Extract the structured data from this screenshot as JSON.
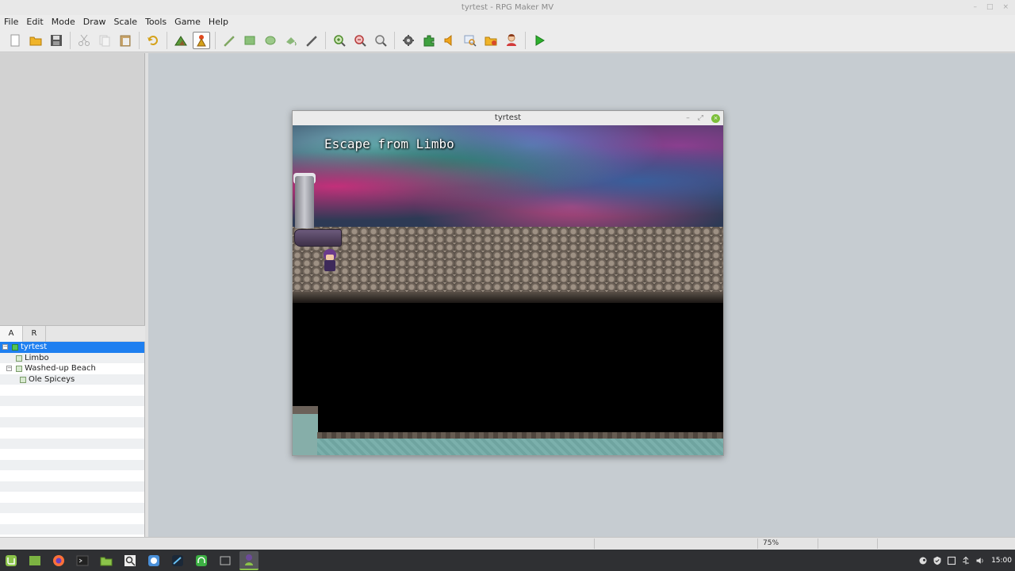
{
  "window": {
    "title": "tyrtest - RPG Maker MV",
    "minimize": "–",
    "maximize": "□",
    "close": "×"
  },
  "menu": [
    "File",
    "Edit",
    "Mode",
    "Draw",
    "Scale",
    "Tools",
    "Game",
    "Help"
  ],
  "toolbar": {
    "icons": [
      "new-icon",
      "open-icon",
      "save-icon",
      "cut-icon",
      "copy-icon",
      "paste-icon",
      "undo-icon",
      "map-mode-icon",
      "event-mode-icon",
      "pencil-icon",
      "rectangle-icon",
      "ellipse-icon",
      "fill-icon",
      "shadow-pen-icon",
      "zoom-in-icon",
      "zoom-out-icon",
      "zoom-actual-icon",
      "database-icon",
      "plugin-manager-icon",
      "sound-test-icon",
      "event-search-icon",
      "resource-manager-icon",
      "character-generator-icon",
      "playtest-icon"
    ],
    "pressed": "event-mode-icon"
  },
  "tabs": {
    "a": "A",
    "r": "R"
  },
  "map_tree": {
    "items": [
      {
        "label": "tyrtest",
        "level": 0,
        "selected": true,
        "expander": "−"
      },
      {
        "label": "Limbo",
        "level": 1,
        "selected": false,
        "expander": ""
      },
      {
        "label": "Washed-up Beach",
        "level": 1,
        "selected": false,
        "expander": "−"
      },
      {
        "label": "Ole Spiceys",
        "level": 2,
        "selected": false,
        "expander": ""
      }
    ]
  },
  "game_window": {
    "title": "tyrtest",
    "minimize": "–",
    "maximize": "⤢",
    "close": "×",
    "map_name": "Escape from Limbo"
  },
  "statusbar": {
    "zoom": "75%"
  },
  "taskbar": {
    "apps": [
      "mint-menu-icon",
      "show-desktop-icon",
      "firefox-icon",
      "terminal-icon",
      "files-icon",
      "search-tool-icon",
      "chromium-icon",
      "steam-icon",
      "headset-icon",
      "window-icon",
      "rpg-maker-icon"
    ],
    "active": "rpg-maker-icon"
  },
  "tray": {
    "icons": [
      "steam-tray-icon",
      "shield-icon",
      "app-tray-icon",
      "network-icon",
      "volume-icon"
    ],
    "clock": "15:00"
  },
  "colors": {
    "selection": "#1e7ff0",
    "taskbar": "#2f3033",
    "map_bg": "#c6ccd1",
    "accent_green": "#8bc34a"
  }
}
